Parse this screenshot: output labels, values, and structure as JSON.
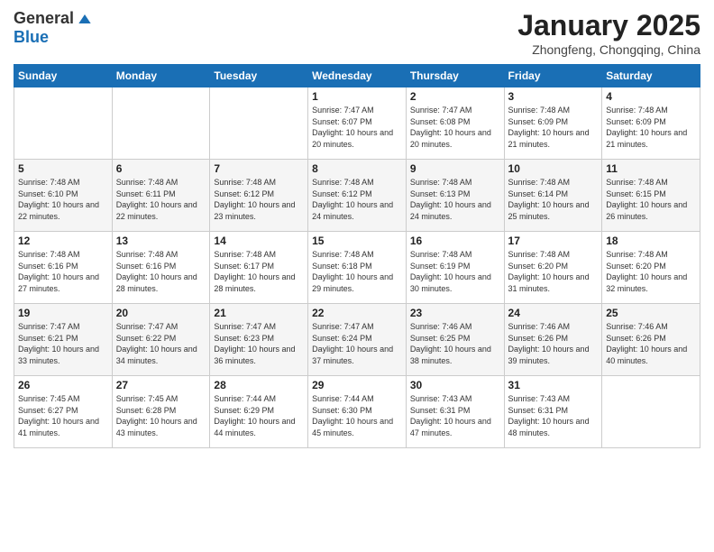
{
  "header": {
    "logo_general": "General",
    "logo_blue": "Blue",
    "month_title": "January 2025",
    "location": "Zhongfeng, Chongqing, China"
  },
  "days_of_week": [
    "Sunday",
    "Monday",
    "Tuesday",
    "Wednesday",
    "Thursday",
    "Friday",
    "Saturday"
  ],
  "weeks": [
    [
      {
        "day": "",
        "sunrise": "",
        "sunset": "",
        "daylight": ""
      },
      {
        "day": "",
        "sunrise": "",
        "sunset": "",
        "daylight": ""
      },
      {
        "day": "",
        "sunrise": "",
        "sunset": "",
        "daylight": ""
      },
      {
        "day": "1",
        "sunrise": "Sunrise: 7:47 AM",
        "sunset": "Sunset: 6:07 PM",
        "daylight": "Daylight: 10 hours and 20 minutes."
      },
      {
        "day": "2",
        "sunrise": "Sunrise: 7:47 AM",
        "sunset": "Sunset: 6:08 PM",
        "daylight": "Daylight: 10 hours and 20 minutes."
      },
      {
        "day": "3",
        "sunrise": "Sunrise: 7:48 AM",
        "sunset": "Sunset: 6:09 PM",
        "daylight": "Daylight: 10 hours and 21 minutes."
      },
      {
        "day": "4",
        "sunrise": "Sunrise: 7:48 AM",
        "sunset": "Sunset: 6:09 PM",
        "daylight": "Daylight: 10 hours and 21 minutes."
      }
    ],
    [
      {
        "day": "5",
        "sunrise": "Sunrise: 7:48 AM",
        "sunset": "Sunset: 6:10 PM",
        "daylight": "Daylight: 10 hours and 22 minutes."
      },
      {
        "day": "6",
        "sunrise": "Sunrise: 7:48 AM",
        "sunset": "Sunset: 6:11 PM",
        "daylight": "Daylight: 10 hours and 22 minutes."
      },
      {
        "day": "7",
        "sunrise": "Sunrise: 7:48 AM",
        "sunset": "Sunset: 6:12 PM",
        "daylight": "Daylight: 10 hours and 23 minutes."
      },
      {
        "day": "8",
        "sunrise": "Sunrise: 7:48 AM",
        "sunset": "Sunset: 6:12 PM",
        "daylight": "Daylight: 10 hours and 24 minutes."
      },
      {
        "day": "9",
        "sunrise": "Sunrise: 7:48 AM",
        "sunset": "Sunset: 6:13 PM",
        "daylight": "Daylight: 10 hours and 24 minutes."
      },
      {
        "day": "10",
        "sunrise": "Sunrise: 7:48 AM",
        "sunset": "Sunset: 6:14 PM",
        "daylight": "Daylight: 10 hours and 25 minutes."
      },
      {
        "day": "11",
        "sunrise": "Sunrise: 7:48 AM",
        "sunset": "Sunset: 6:15 PM",
        "daylight": "Daylight: 10 hours and 26 minutes."
      }
    ],
    [
      {
        "day": "12",
        "sunrise": "Sunrise: 7:48 AM",
        "sunset": "Sunset: 6:16 PM",
        "daylight": "Daylight: 10 hours and 27 minutes."
      },
      {
        "day": "13",
        "sunrise": "Sunrise: 7:48 AM",
        "sunset": "Sunset: 6:16 PM",
        "daylight": "Daylight: 10 hours and 28 minutes."
      },
      {
        "day": "14",
        "sunrise": "Sunrise: 7:48 AM",
        "sunset": "Sunset: 6:17 PM",
        "daylight": "Daylight: 10 hours and 28 minutes."
      },
      {
        "day": "15",
        "sunrise": "Sunrise: 7:48 AM",
        "sunset": "Sunset: 6:18 PM",
        "daylight": "Daylight: 10 hours and 29 minutes."
      },
      {
        "day": "16",
        "sunrise": "Sunrise: 7:48 AM",
        "sunset": "Sunset: 6:19 PM",
        "daylight": "Daylight: 10 hours and 30 minutes."
      },
      {
        "day": "17",
        "sunrise": "Sunrise: 7:48 AM",
        "sunset": "Sunset: 6:20 PM",
        "daylight": "Daylight: 10 hours and 31 minutes."
      },
      {
        "day": "18",
        "sunrise": "Sunrise: 7:48 AM",
        "sunset": "Sunset: 6:20 PM",
        "daylight": "Daylight: 10 hours and 32 minutes."
      }
    ],
    [
      {
        "day": "19",
        "sunrise": "Sunrise: 7:47 AM",
        "sunset": "Sunset: 6:21 PM",
        "daylight": "Daylight: 10 hours and 33 minutes."
      },
      {
        "day": "20",
        "sunrise": "Sunrise: 7:47 AM",
        "sunset": "Sunset: 6:22 PM",
        "daylight": "Daylight: 10 hours and 34 minutes."
      },
      {
        "day": "21",
        "sunrise": "Sunrise: 7:47 AM",
        "sunset": "Sunset: 6:23 PM",
        "daylight": "Daylight: 10 hours and 36 minutes."
      },
      {
        "day": "22",
        "sunrise": "Sunrise: 7:47 AM",
        "sunset": "Sunset: 6:24 PM",
        "daylight": "Daylight: 10 hours and 37 minutes."
      },
      {
        "day": "23",
        "sunrise": "Sunrise: 7:46 AM",
        "sunset": "Sunset: 6:25 PM",
        "daylight": "Daylight: 10 hours and 38 minutes."
      },
      {
        "day": "24",
        "sunrise": "Sunrise: 7:46 AM",
        "sunset": "Sunset: 6:26 PM",
        "daylight": "Daylight: 10 hours and 39 minutes."
      },
      {
        "day": "25",
        "sunrise": "Sunrise: 7:46 AM",
        "sunset": "Sunset: 6:26 PM",
        "daylight": "Daylight: 10 hours and 40 minutes."
      }
    ],
    [
      {
        "day": "26",
        "sunrise": "Sunrise: 7:45 AM",
        "sunset": "Sunset: 6:27 PM",
        "daylight": "Daylight: 10 hours and 41 minutes."
      },
      {
        "day": "27",
        "sunrise": "Sunrise: 7:45 AM",
        "sunset": "Sunset: 6:28 PM",
        "daylight": "Daylight: 10 hours and 43 minutes."
      },
      {
        "day": "28",
        "sunrise": "Sunrise: 7:44 AM",
        "sunset": "Sunset: 6:29 PM",
        "daylight": "Daylight: 10 hours and 44 minutes."
      },
      {
        "day": "29",
        "sunrise": "Sunrise: 7:44 AM",
        "sunset": "Sunset: 6:30 PM",
        "daylight": "Daylight: 10 hours and 45 minutes."
      },
      {
        "day": "30",
        "sunrise": "Sunrise: 7:43 AM",
        "sunset": "Sunset: 6:31 PM",
        "daylight": "Daylight: 10 hours and 47 minutes."
      },
      {
        "day": "31",
        "sunrise": "Sunrise: 7:43 AM",
        "sunset": "Sunset: 6:31 PM",
        "daylight": "Daylight: 10 hours and 48 minutes."
      },
      {
        "day": "",
        "sunrise": "",
        "sunset": "",
        "daylight": ""
      }
    ]
  ]
}
